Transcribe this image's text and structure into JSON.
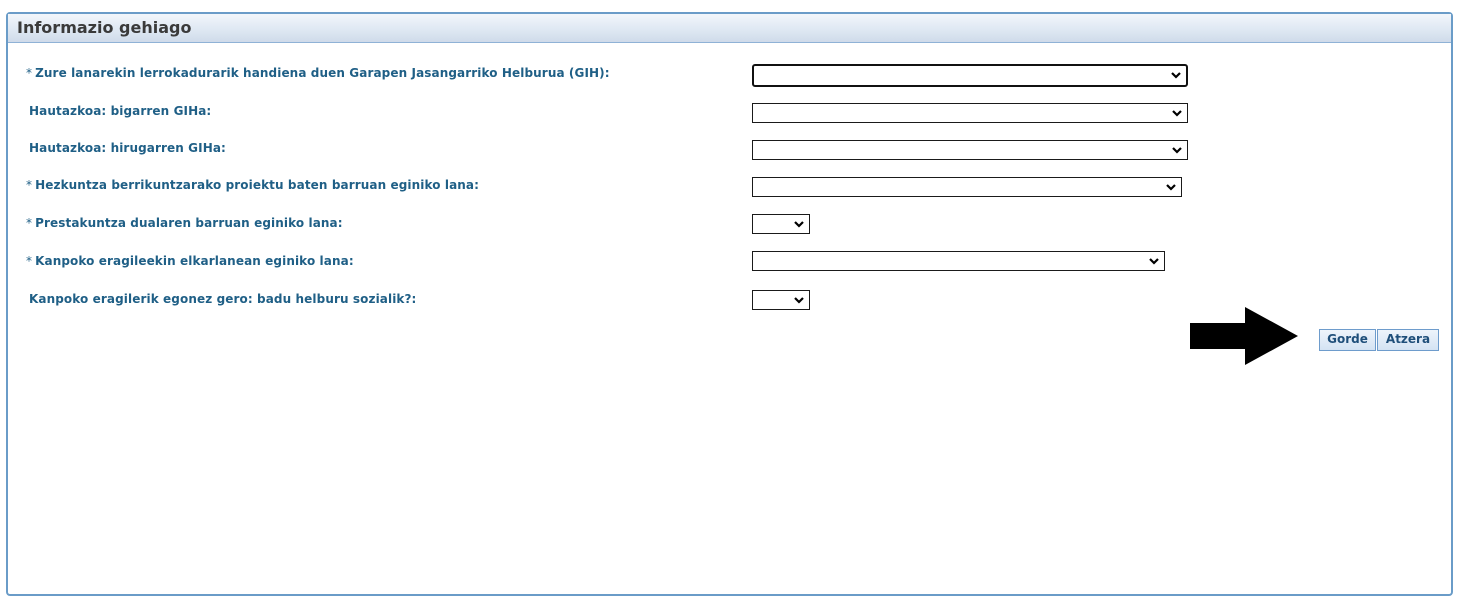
{
  "dialog": {
    "title": "Informazio gehiago"
  },
  "fields": [
    {
      "required": true,
      "required_mark": "*",
      "label": "Zure lanarekin lerrokadurarik handiena duen Garapen Jasangarriko Helburua (GIH):",
      "value": ""
    },
    {
      "required": false,
      "required_mark": "",
      "label": "Hautazkoa: bigarren GIHa:",
      "value": ""
    },
    {
      "required": false,
      "required_mark": "",
      "label": "Hautazkoa: hirugarren GIHa:",
      "value": ""
    },
    {
      "required": true,
      "required_mark": "*",
      "label": "Hezkuntza berrikuntzarako proiektu baten barruan eginiko lana:",
      "value": ""
    },
    {
      "required": true,
      "required_mark": "*",
      "label": "Prestakuntza dualaren barruan eginiko lana:",
      "value": ""
    },
    {
      "required": true,
      "required_mark": "*",
      "label": "Kanpoko eragileekin elkarlanean eginiko lana:",
      "value": ""
    },
    {
      "required": false,
      "required_mark": "",
      "label": "Kanpoko eragilerik egonez gero: badu helburu sozialik?:",
      "value": ""
    }
  ],
  "buttons": {
    "save_label": "Gorde",
    "back_label": "Atzera"
  },
  "annotation": {
    "icon": "arrow-right-icon",
    "color": "#000000"
  },
  "colors": {
    "label": "#1f5f86",
    "titlebar_border": "#6a9cc8"
  }
}
